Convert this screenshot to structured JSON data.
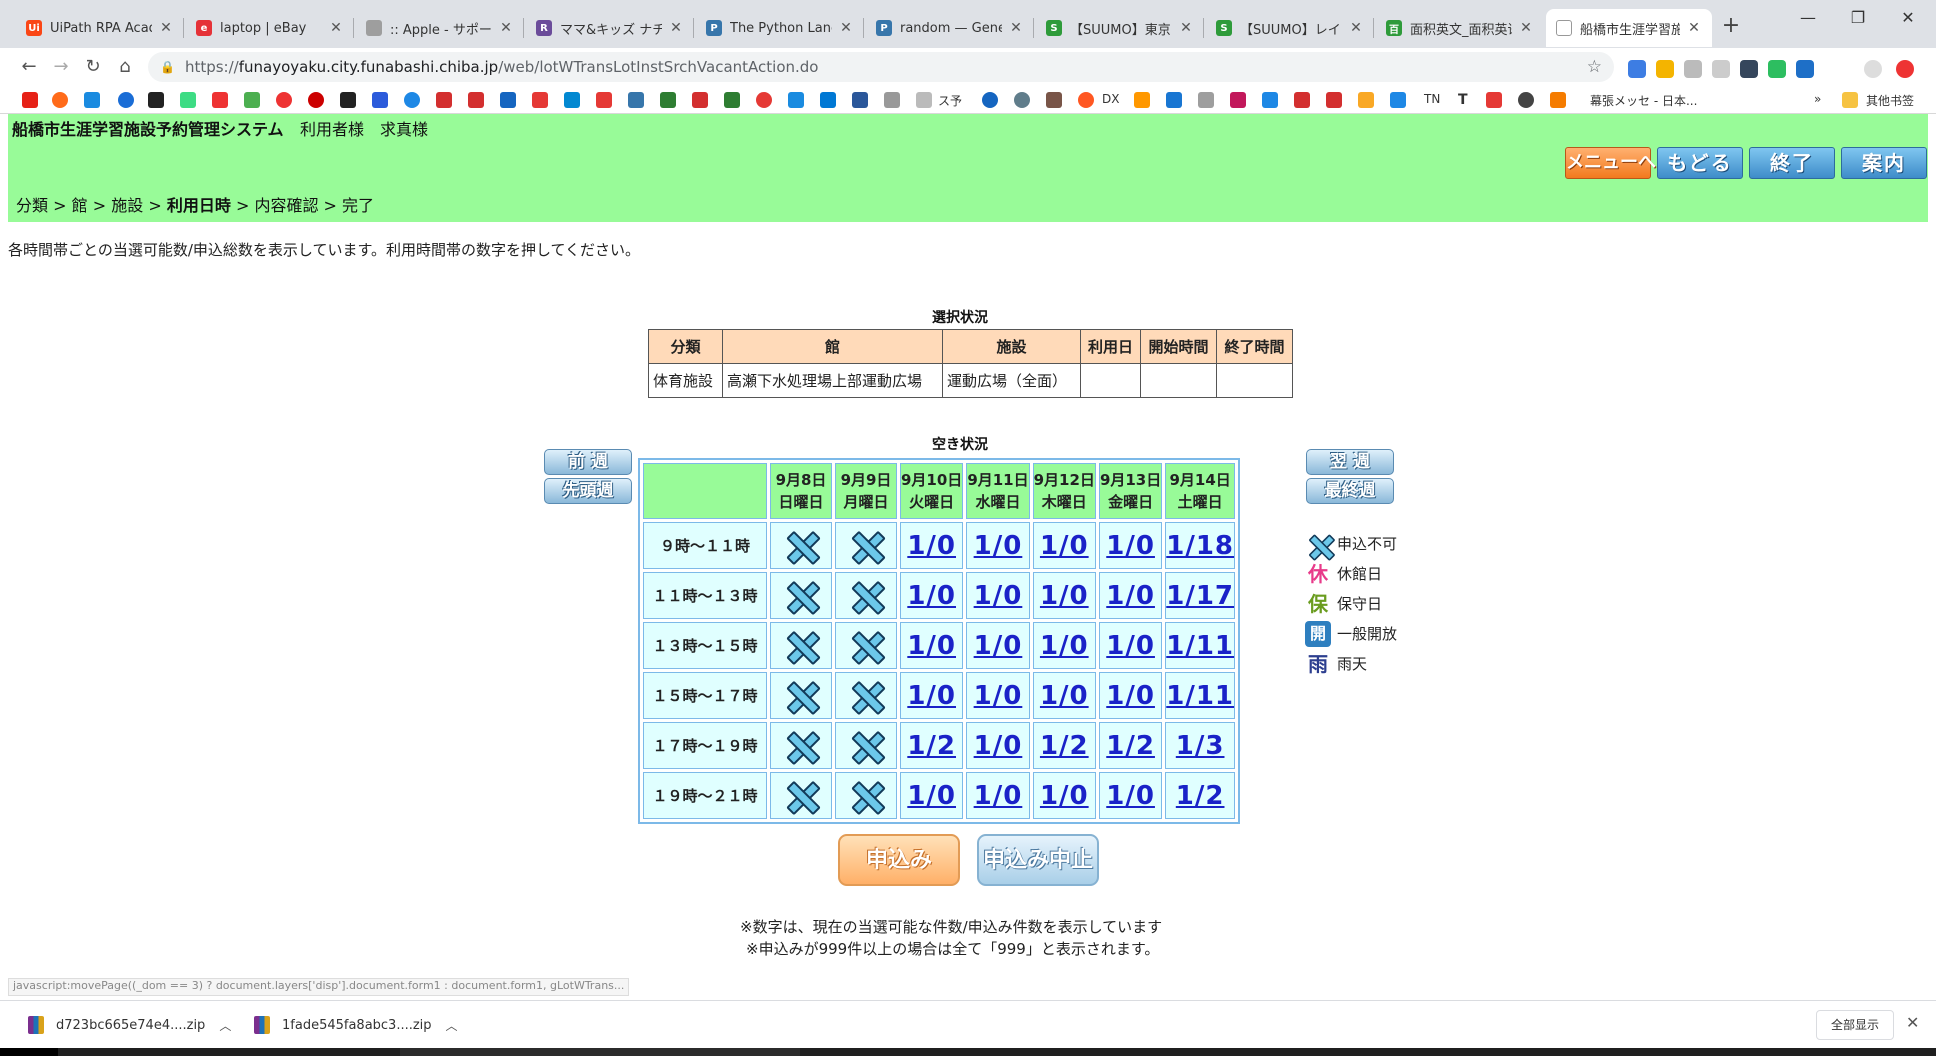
{
  "browser": {
    "tabs": [
      {
        "title": "UiPath RPA Acade",
        "fav_color": "#fa4616",
        "fav_text": "Ui"
      },
      {
        "title": "laptop | eBay",
        "fav_color": "#e53238",
        "fav_text": "e"
      },
      {
        "title": ":: Apple - サポート",
        "fav_color": "#9e9e9e",
        "fav_text": ""
      },
      {
        "title": "ママ&キッズ ナチ",
        "fav_color": "#6b4c9a",
        "fav_text": "R"
      },
      {
        "title": "The Python Langu",
        "fav_color": "#3776ab",
        "fav_text": "P"
      },
      {
        "title": "random — Genera",
        "fav_color": "#3776ab",
        "fav_text": "P"
      },
      {
        "title": "【SUUMO】東京メ",
        "fav_color": "#2e9b3a",
        "fav_text": "S"
      },
      {
        "title": "【SUUMO】レイン",
        "fav_color": "#2e9b3a",
        "fav_text": "S"
      },
      {
        "title": "面积英文_面积英语",
        "fav_color": "#2e9b3a",
        "fav_text": "百"
      },
      {
        "title": "船橋市生涯学習施設",
        "fav_color": "#dddddd",
        "fav_text": ""
      }
    ],
    "new_tab": "+",
    "url_host": "funayoyaku.city.funabashi.chiba.jp",
    "url_path": "/web/lotWTransLotInstSrchVacantAction.do",
    "bookmark_texts": {
      "suyo": "ス予",
      "dx": "DX",
      "tn": "TN",
      "t": "T",
      "messe": "幕張メッセ - 日本...",
      "more": "»",
      "other": "其他书签"
    }
  },
  "header": {
    "system_name": "船橋市生涯学習施設予約管理システム",
    "user_label": "利用者様",
    "user_name": "求真様",
    "buttons": {
      "menu": "メニューへ",
      "back": "もどる",
      "exit": "終了",
      "guide": "案内"
    }
  },
  "breadcrumb": {
    "items": [
      "分類",
      "館",
      "施設",
      "利用日時",
      "内容確認",
      "完了"
    ],
    "sep": ">",
    "current_index": 3
  },
  "instruction": "各時間帯ごとの当選可能数/申込総数を表示しています。利用時間帯の数字を押してください。",
  "selection": {
    "caption": "選択状況",
    "headers": [
      "分類",
      "館",
      "施設",
      "利用日",
      "開始時間",
      "終了時間"
    ],
    "row": [
      "体育施設",
      "高瀬下水処理場上部運動広場",
      "運動広場（全面）",
      "",
      "",
      ""
    ]
  },
  "availability": {
    "caption": "空き状況",
    "days": [
      {
        "date": "9月8日",
        "dow": "日曜日"
      },
      {
        "date": "9月9日",
        "dow": "月曜日"
      },
      {
        "date": "9月10日",
        "dow": "火曜日"
      },
      {
        "date": "9月11日",
        "dow": "水曜日"
      },
      {
        "date": "9月12日",
        "dow": "木曜日"
      },
      {
        "date": "9月13日",
        "dow": "金曜日"
      },
      {
        "date": "9月14日",
        "dow": "土曜日"
      }
    ],
    "rows": [
      {
        "time": "９時～１１時",
        "cells": [
          "x",
          "x",
          "1/0",
          "1/0",
          "1/0",
          "1/0",
          "1/18"
        ]
      },
      {
        "time": "１１時～１３時",
        "cells": [
          "x",
          "x",
          "1/0",
          "1/0",
          "1/0",
          "1/0",
          "1/17"
        ]
      },
      {
        "time": "１３時～１５時",
        "cells": [
          "x",
          "x",
          "1/0",
          "1/0",
          "1/0",
          "1/0",
          "1/11"
        ]
      },
      {
        "time": "１５時～１７時",
        "cells": [
          "x",
          "x",
          "1/0",
          "1/0",
          "1/0",
          "1/0",
          "1/11"
        ]
      },
      {
        "time": "１７時～１９時",
        "cells": [
          "x",
          "x",
          "1/2",
          "1/0",
          "1/2",
          "1/2",
          "1/3"
        ]
      },
      {
        "time": "１９時～２１時",
        "cells": [
          "x",
          "x",
          "1/0",
          "1/0",
          "1/0",
          "1/0",
          "1/2"
        ]
      }
    ],
    "nav": {
      "prev_week": "前 週",
      "first_week": "先頭週",
      "next_week": "翌 週",
      "last_week": "最終週"
    }
  },
  "legend": [
    {
      "icon": "x-mark-icon",
      "glyph": "",
      "label": "申込不可"
    },
    {
      "icon": "kyu-icon",
      "glyph": "休",
      "label": "休館日"
    },
    {
      "icon": "ho-icon",
      "glyph": "保",
      "label": "保守日"
    },
    {
      "icon": "kai-icon",
      "glyph": "開",
      "label": "一般開放"
    },
    {
      "icon": "ame-icon",
      "glyph": "雨",
      "label": "雨天"
    }
  ],
  "actions": {
    "apply": "申込み",
    "cancel": "申込み中止"
  },
  "notes": [
    "※数字は、現在の当選可能な件数/申込み件数を表示しています",
    "※申込みが999件以上の場合は全て「999」と表示されます。"
  ],
  "status_url": "javascript:movePage((_dom == 3) ? document.layers['disp'].document.form1 : document.form1, gLotWTrans...",
  "downloads": [
    {
      "name": "d723bc665e74e4....zip"
    },
    {
      "name": "1fade545fa8abc3....zip"
    }
  ],
  "show_all": "全部显示",
  "colors": {
    "green": "#98fb98",
    "peach": "#ffdab9",
    "cell": "#e0ffff",
    "link": "#1a22c8"
  }
}
